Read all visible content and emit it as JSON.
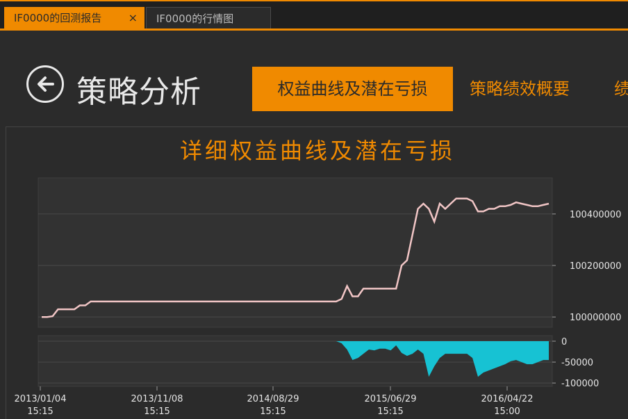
{
  "tabs": [
    {
      "label": "IF0000的回测报告",
      "active": true,
      "close_icon": "×"
    },
    {
      "label": "IF0000的行情图",
      "active": false
    }
  ],
  "header": {
    "back_icon": "arrow-left-circle",
    "title": "策略分析",
    "nav": [
      {
        "label": "权益曲线及潜在亏损",
        "active": true
      },
      {
        "label": "策略绩效概要",
        "active": false
      },
      {
        "label": "绩",
        "active": false
      }
    ]
  },
  "colors": {
    "accent": "#f08a00",
    "equity_line": "#f2c6c6",
    "drawdown_fill": "#17c2d3"
  },
  "chart_data": [
    {
      "type": "line",
      "title": "详细权益曲线及潜在亏损",
      "y_ticks": [
        "100000000",
        "100200000",
        "100400000"
      ],
      "ylim": [
        99960000,
        100540000
      ],
      "series": [
        {
          "values": [
            100000000,
            100000000,
            100003000,
            100030000,
            100030000,
            100030000,
            100030000,
            100045000,
            100045000,
            100060000,
            100060000,
            100060000,
            100060000,
            100060000,
            100060000,
            100060000,
            100060000,
            100060000,
            100060000,
            100060000,
            100060000,
            100060000,
            100060000,
            100060000,
            100060000,
            100060000,
            100060000,
            100060000,
            100060000,
            100060000,
            100060000,
            100060000,
            100060000,
            100060000,
            100060000,
            100060000,
            100060000,
            100060000,
            100060000,
            100060000,
            100060000,
            100060000,
            100060000,
            100060000,
            100060000,
            100060000,
            100060000,
            100060000,
            100060000,
            100060000,
            100060000,
            100060000,
            100060000,
            100060000,
            100060000,
            100070000,
            100120000,
            100080000,
            100080000,
            100110000,
            100110000,
            100110000,
            100110000,
            100110000,
            100110000,
            100110000,
            100200000,
            100220000,
            100320000,
            100420000,
            100440000,
            100420000,
            100370000,
            100440000,
            100420000,
            100440000,
            100460000,
            100460000,
            100460000,
            100450000,
            100410000,
            100410000,
            100420000,
            100420000,
            100430000,
            100430000,
            100435000,
            100445000,
            100440000,
            100435000,
            100430000,
            100430000,
            100435000,
            100440000
          ]
        }
      ]
    },
    {
      "type": "area",
      "y_ticks": [
        "0",
        "-50000",
        "-100000"
      ],
      "ylim": [
        -108000,
        0
      ],
      "series": [
        {
          "values": [
            0,
            0,
            0,
            0,
            0,
            0,
            0,
            0,
            0,
            0,
            0,
            0,
            0,
            0,
            0,
            0,
            0,
            0,
            0,
            0,
            0,
            0,
            0,
            0,
            0,
            0,
            0,
            0,
            0,
            0,
            0,
            0,
            0,
            0,
            0,
            0,
            0,
            0,
            0,
            0,
            0,
            0,
            0,
            0,
            0,
            0,
            0,
            0,
            0,
            0,
            0,
            0,
            0,
            0,
            0,
            -5000,
            -20000,
            -45000,
            -40000,
            -30000,
            -20000,
            -22000,
            -18000,
            -18000,
            -22000,
            -10000,
            -28000,
            -35000,
            -30000,
            -20000,
            -30000,
            -85000,
            -60000,
            -40000,
            -30000,
            -30000,
            -30000,
            -30000,
            -30000,
            -40000,
            -85000,
            -75000,
            -70000,
            -65000,
            -60000,
            -55000,
            -48000,
            -45000,
            -50000,
            -55000,
            -55000,
            -50000,
            -45000,
            -45000
          ]
        }
      ]
    }
  ],
  "x_ticks": [
    {
      "date": "2013/01/04",
      "time": "15:15"
    },
    {
      "date": "2013/11/08",
      "time": "15:15"
    },
    {
      "date": "2014/08/29",
      "time": "15:15"
    },
    {
      "date": "2015/06/29",
      "time": "15:15"
    },
    {
      "date": "2016/04/22",
      "time": "15:00"
    }
  ]
}
